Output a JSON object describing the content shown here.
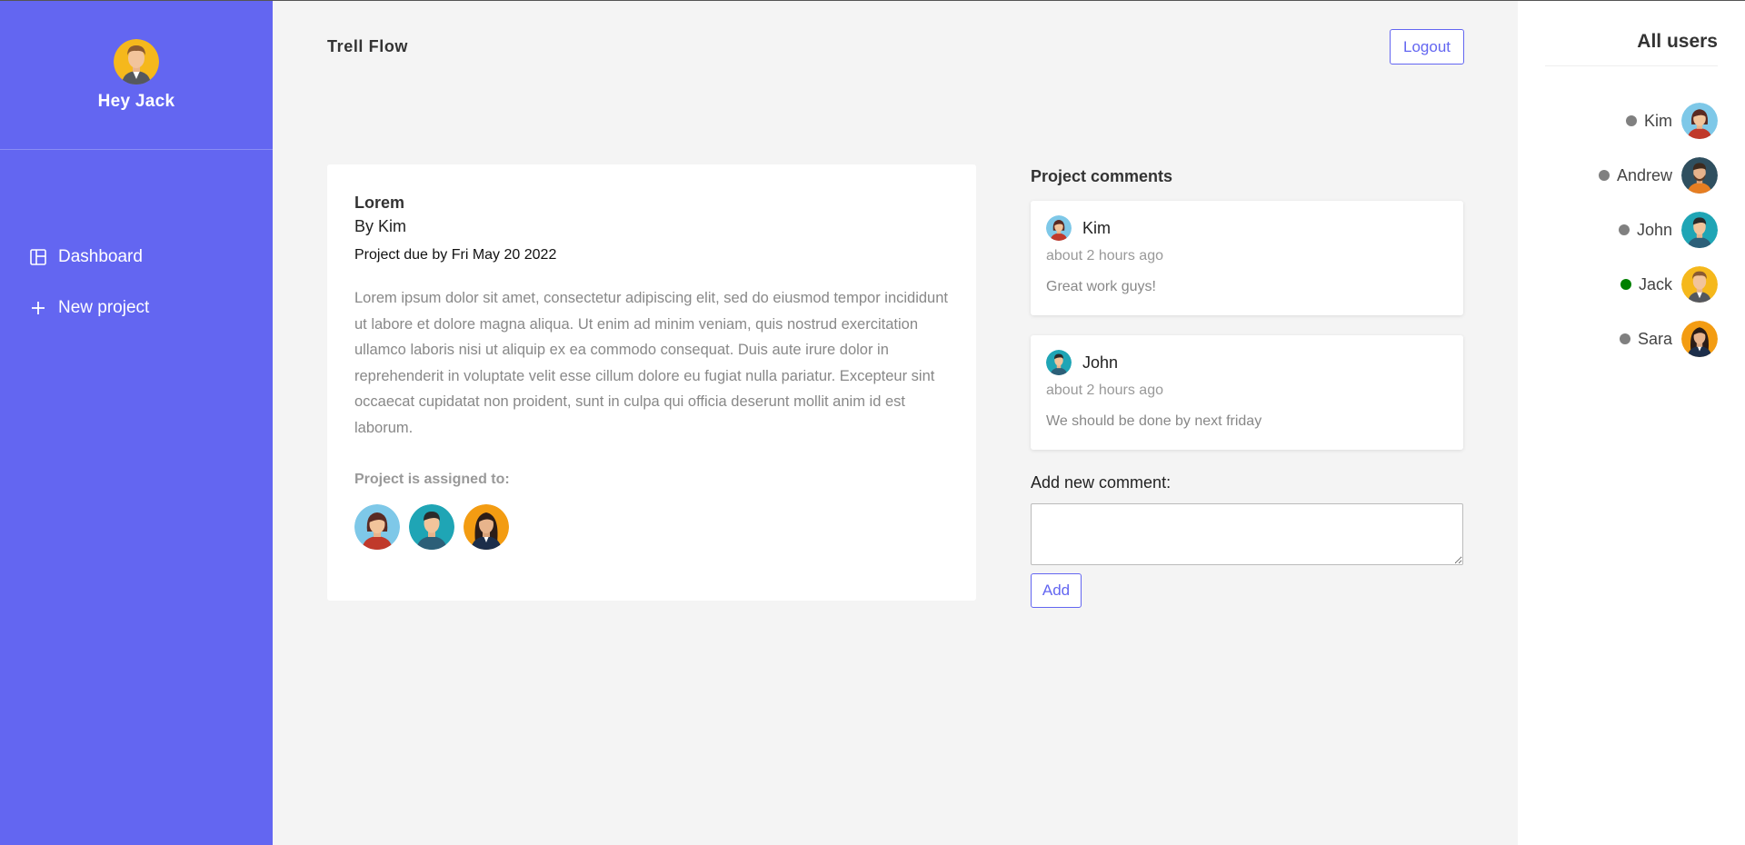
{
  "sidebar": {
    "greeting": "Hey Jack",
    "avatar_icon": "jack-avatar",
    "nav": [
      {
        "label": "Dashboard",
        "icon": "dashboard-icon"
      },
      {
        "label": "New project",
        "icon": "plus-icon"
      }
    ]
  },
  "header": {
    "brand": "Trell Flow",
    "logout_label": "Logout"
  },
  "project": {
    "title": "Lorem",
    "author": "By Kim",
    "due": "Project due by Fri May 20 2022",
    "description": "Lorem ipsum dolor sit amet, consectetur adipiscing elit, sed do eiusmod tempor incididunt ut labore et dolore magna aliqua. Ut enim ad minim veniam, quis nostrud exercitation ullamco laboris nisi ut aliquip ex ea commodo consequat. Duis aute irure dolor in reprehenderit in voluptate velit esse cillum dolore eu fugiat nulla pariatur. Excepteur sint occaecat cupidatat non proident, sunt in culpa qui officia deserunt mollit anim id est laborum.",
    "assigned_label": "Project is assigned to:",
    "assigned": [
      "kim-avatar",
      "john-avatar",
      "sara-avatar"
    ]
  },
  "comments": {
    "heading": "Project comments",
    "items": [
      {
        "author": "Kim",
        "time": "about 2 hours ago",
        "text": "Great work guys!"
      },
      {
        "author": "John",
        "time": "about 2 hours ago",
        "text": "We should be done by next friday"
      }
    ],
    "add_label": "Add new comment:",
    "input_value": "",
    "add_button": "Add"
  },
  "users": {
    "title": "All users",
    "list": [
      {
        "name": "Kim",
        "status_color": "#808080"
      },
      {
        "name": "Andrew",
        "status_color": "#808080"
      },
      {
        "name": "John",
        "status_color": "#808080"
      },
      {
        "name": "Jack",
        "status_color": "#008000"
      },
      {
        "name": "Sara",
        "status_color": "#808080"
      }
    ]
  },
  "colors": {
    "accent": "#6366f1",
    "background": "#f4f4f4",
    "online": "#008000",
    "offline": "#808080"
  }
}
